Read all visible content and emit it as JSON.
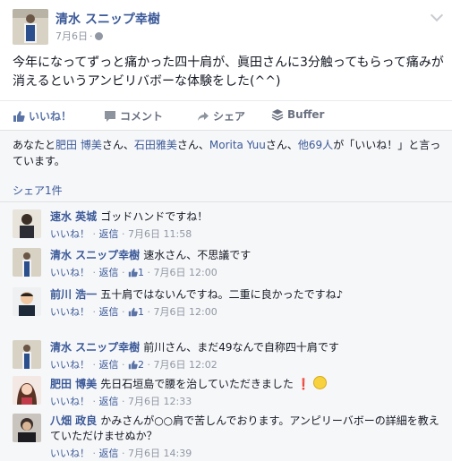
{
  "post": {
    "author": "清水 スニップ幸樹",
    "date": "7月6日",
    "separator": "·",
    "message": "今年になってずっと痛かった四十肩が、眞田さんに3分触ってもらって痛みが消えるというアンビリバボーな体験をした(^^)"
  },
  "actions": {
    "like": "いいね！",
    "comment": "コメント",
    "share": "シェア",
    "buffer": "Buffer"
  },
  "likes": {
    "prefix": "あなたと",
    "name1": "肥田 博美",
    "sep1": "さん、",
    "name2": "石田雅美",
    "sep2": "さん、",
    "name3": "Morita Yuu",
    "sep3": "さん、",
    "others": "他69人",
    "suffix": "が「いいね！」と言っています。"
  },
  "shares": "シェア1件",
  "comments": [
    {
      "name": "速水 英城",
      "text": "ゴッドハンドですね！",
      "like": "いいね！",
      "reply": "返信",
      "likes_count": "",
      "date": "7月6日 11:58"
    },
    {
      "name": "清水 スニップ幸樹",
      "text": "速水さん、不思議です",
      "like": "いいね！",
      "reply": "返信",
      "likes_count": "1",
      "date": "7月6日 12:00"
    },
    {
      "name": "前川 浩一",
      "text": "五十肩ではないんですね。二重に良かったですね♪",
      "like": "いいね！",
      "reply": "返信",
      "likes_count": "1",
      "date": "7月6日 12:00"
    },
    {
      "name": "清水 スニップ幸樹",
      "text": "前川さん、まだ49なんで自称四十肩です",
      "like": "いいね！",
      "reply": "返信",
      "likes_count": "2",
      "date": "7月6日 12:02"
    },
    {
      "name": "肥田 博美",
      "text": "先日石垣島で腰を治していただきました",
      "like": "いいね！",
      "reply": "返信",
      "likes_count": "",
      "date": "7月6日 12:33"
    },
    {
      "name": "八畑 政良",
      "text": "かみさんが○○肩で苦しんでおります。アンピリーバボーの詳細を教えていただけませぬか？",
      "like": "いいね！",
      "reply": "返信",
      "likes_count": "",
      "date": "7月6日 14:39"
    }
  ],
  "meta_sep": "·",
  "colors": {
    "link": "#3b5998",
    "muted": "#9197a3",
    "text": "#141823"
  },
  "icons": {
    "globe": "globe-icon",
    "like": "thumbs-up-icon",
    "comment": "comment-icon",
    "share": "share-arrow-icon",
    "buffer": "buffer-stack-icon",
    "options": "chevron-down-icon"
  }
}
